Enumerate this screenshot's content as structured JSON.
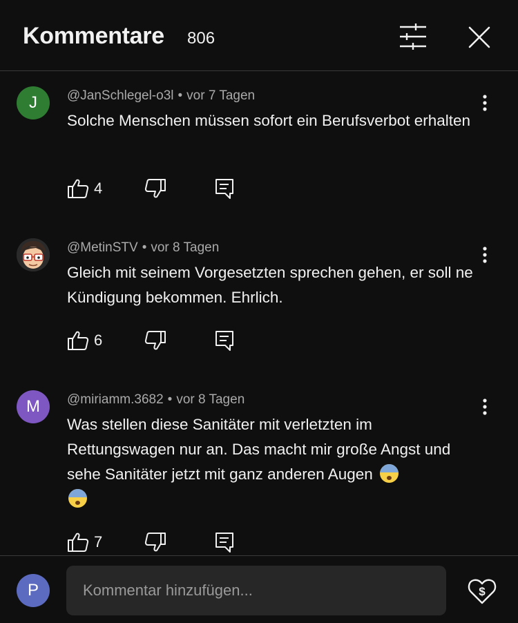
{
  "header": {
    "title": "Kommentare",
    "count": "806",
    "sort_icon": "sliders-icon",
    "close_icon": "close-icon"
  },
  "comments": [
    {
      "author": "@JanSchlegel-o3l",
      "time": "vor 7 Tagen",
      "avatar_letter": "J",
      "avatar_color": "#2e7d32",
      "text": "Solche Menschen müssen sofort ein Berufsverbot erhalten",
      "likes": "4"
    },
    {
      "author": "@MetinSTV",
      "time": "vor 8 Tagen",
      "avatar_letter": "",
      "avatar_color": "#3b3b3b",
      "avatar_icon": "cartoon-face-avatar",
      "text": "Gleich mit seinem Vorgesetzten sprechen gehen, er soll ne Kündigung bekommen. Ehrlich.",
      "likes": "6"
    },
    {
      "author": "@miriamm.3682",
      "time": "vor 8 Tagen",
      "avatar_letter": "M",
      "avatar_color": "#7e57c2",
      "text": "Was stellen diese Sanitäter mit verletzten im Rettungswagen nur an. Das macht mir große Angst und sehe Sanitäter jetzt mit ganz anderen Augen",
      "emoji": "😨",
      "likes": "7"
    }
  ],
  "composer": {
    "user_letter": "P",
    "user_avatar_color": "#5c6bc0",
    "placeholder": "Kommentar hinzufügen...",
    "thanks_icon": "heart-dollar-icon"
  }
}
